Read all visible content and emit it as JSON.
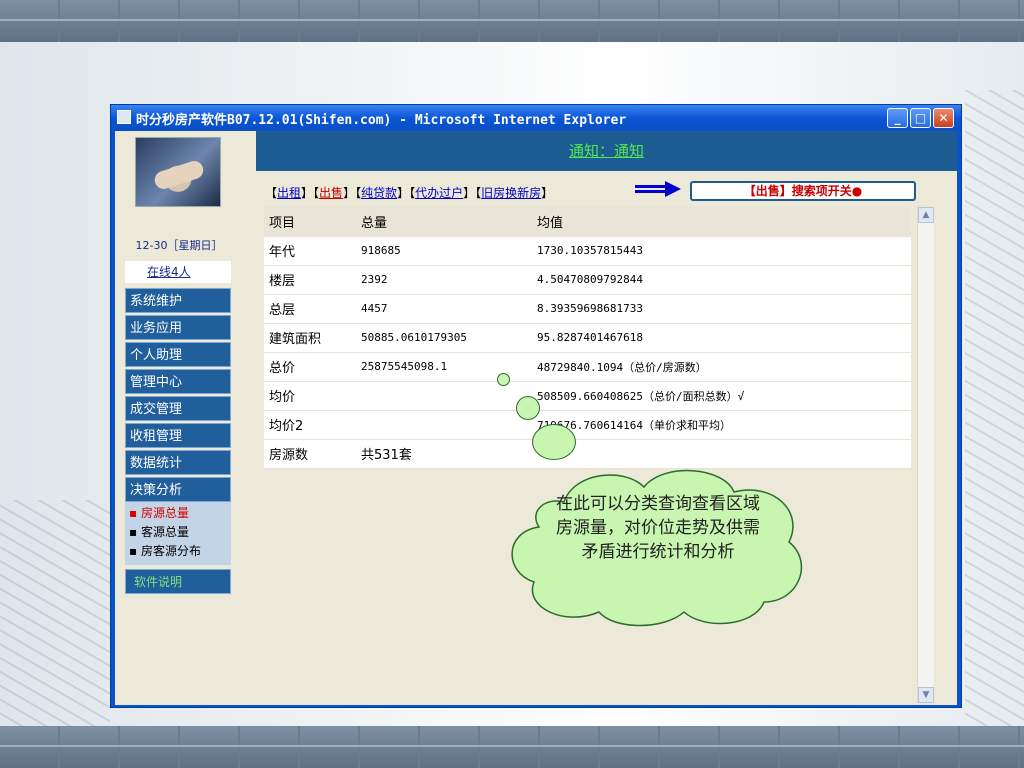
{
  "window": {
    "title": "时分秒房产软件B07.12.01(Shifen.com) - Microsoft Internet Explorer",
    "min_icon": "minimize-icon",
    "max_icon": "maximize-icon",
    "close_icon": "close-icon"
  },
  "sidebar": {
    "date": "12-30［星期日］",
    "online": "在线4人",
    "menu": [
      "系统维护",
      "业务应用",
      "个人助理",
      "管理中心",
      "成交管理",
      "收租管理",
      "数据统计",
      "决策分析"
    ],
    "submenu": [
      "▪ 房源总量",
      "▪ 客源总量",
      "▪ 房客源分布"
    ],
    "help": "软件说明"
  },
  "notice": {
    "text": "通知：通知"
  },
  "links": {
    "items": [
      "出租",
      "出售",
      "纯贷款",
      "代办过户",
      "旧房换新房"
    ],
    "toggle_label": "【出售】搜索项开关●"
  },
  "table": {
    "headers": [
      "项目",
      "总量",
      "均值"
    ],
    "rows": [
      [
        "年代",
        "918685",
        "1730.10357815443"
      ],
      [
        "楼层",
        "2392",
        "4.50470809792844"
      ],
      [
        "总层",
        "4457",
        "8.39359698681733"
      ],
      [
        "建筑面积",
        "50885.0610179305",
        "95.8287401467618"
      ],
      [
        "总价",
        "25875545098.1",
        "48729840.1094（总价/房源数）"
      ],
      [
        "均价",
        "",
        "508509.660408625（总价/面积总数）√"
      ],
      [
        "均价2",
        "",
        "719676.760614164（单价求和平均）"
      ],
      [
        "房源数",
        "共531套",
        ""
      ]
    ]
  },
  "annotation": {
    "text": "在此可以分类查询查看区域房源量，对价位走势及供需矛盾进行统计和分析"
  },
  "colors": {
    "titlebar": "#0a53c8",
    "menu_bg": "#215f9c",
    "notice_bg": "#1c5c92",
    "notice_text": "#53e84e",
    "bubble": "#c8f5b0"
  }
}
